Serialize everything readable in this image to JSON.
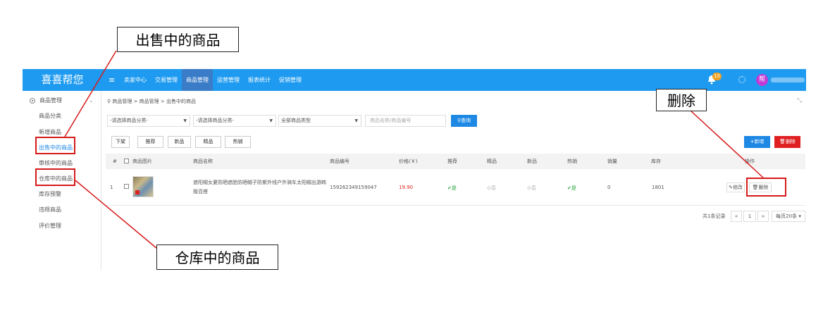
{
  "app": {
    "logo": "喜喜帮您",
    "menu_toggle": "≡"
  },
  "nav": [
    "卖家中心",
    "交易管理",
    "商品管理",
    "运营管理",
    "报表统计",
    "促销管理"
  ],
  "header": {
    "notification_count": "10",
    "avatar_text": "帮"
  },
  "sidebar": {
    "group_label": "商品管理",
    "items": [
      "商品分类",
      "新增商品",
      "出售中的商品",
      "审核中的商品",
      "仓库中的商品",
      "库存预警",
      "违规商品",
      "评价管理"
    ]
  },
  "breadcrumb": "商品管理 > 商品管理 > 出售中的商品",
  "filters": {
    "category1": "-请选择商品分类-",
    "category2": "-请选择商品分类-",
    "type": "全部商品类型",
    "search_placeholder": "商品名称/商品编号",
    "query_label": "查询"
  },
  "actions": [
    "下架",
    "推荐",
    "新品",
    "精品",
    "热销"
  ],
  "toolbar": {
    "add_label": "新增",
    "delete_label": "删除"
  },
  "table": {
    "headers": [
      "#",
      "商品图片",
      "商品名称",
      "商品编号",
      "价格(￥)",
      "推荐",
      "精品",
      "新品",
      "热销",
      "销量",
      "库存",
      "操作"
    ],
    "rows": [
      {
        "index": "1",
        "name": "遮阳帽女夏防晒遮脸防晒帽子防紫外线户外骑车太阳帽出游韩版百搭",
        "code": "159262349159047",
        "price": "19.90",
        "recommend": "是",
        "boutique": "否",
        "new": "否",
        "hot": "是",
        "sales": "0",
        "stock": "1801",
        "edit_label": "修改",
        "delete_label": "删除"
      }
    ]
  },
  "pager": {
    "total": "共1条记录",
    "prev": "«",
    "page": "1",
    "next": "»",
    "page_size": "每页20条"
  },
  "annotations": {
    "selling": "出售中的商品",
    "warehouse": "仓库中的商品",
    "delete": "删除"
  },
  "colors": {
    "primary": "#1e9bf0",
    "danger": "#e02020",
    "annotation": "#d61a1a"
  }
}
